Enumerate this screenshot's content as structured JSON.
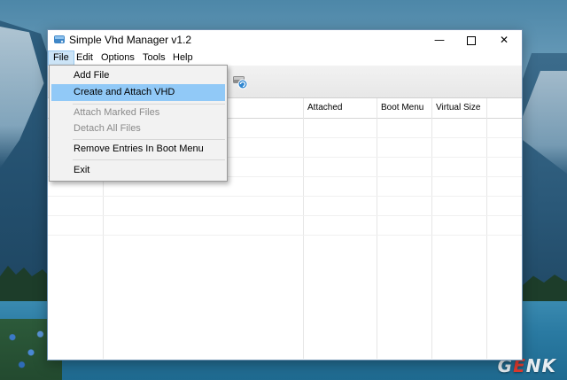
{
  "window": {
    "title": "Simple Vhd Manager v1.2",
    "minimize_glyph": "—",
    "close_glyph": "✕"
  },
  "menubar": {
    "items": [
      {
        "label": "File",
        "active": true
      },
      {
        "label": "Edit"
      },
      {
        "label": "Options"
      },
      {
        "label": "Tools"
      },
      {
        "label": "Help"
      }
    ]
  },
  "file_menu": {
    "items": [
      {
        "label": "Add File",
        "enabled": true
      },
      {
        "label": "Create and Attach VHD",
        "enabled": true,
        "highlighted": true
      },
      {
        "label": "Attach Marked Files",
        "enabled": false
      },
      {
        "label": "Detach All Files",
        "enabled": false
      },
      {
        "label": "Remove Entries In Boot Menu",
        "enabled": true
      },
      {
        "label": "Exit",
        "enabled": true
      }
    ]
  },
  "grid": {
    "columns": [
      "Attached",
      "Boot Menu",
      "Virtual Size"
    ]
  },
  "watermark": {
    "g": "G",
    "e": "E",
    "nk": "NK"
  },
  "colors": {
    "highlight": "#91c9f7",
    "menu_active": "#cce4f7",
    "disabled_text": "#8a8a8a"
  },
  "icons": [
    "app-disk-icon",
    "attach-disk-icon",
    "minimize-icon",
    "maximize-icon",
    "close-icon"
  ]
}
